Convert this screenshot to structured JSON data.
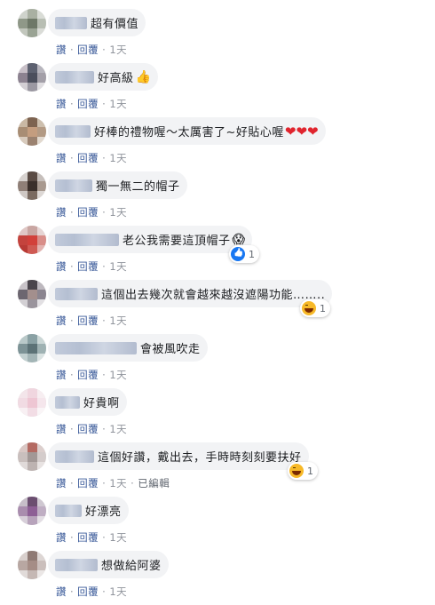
{
  "actions": {
    "like": "讚",
    "reply": "回覆",
    "separator": "·"
  },
  "comments": [
    {
      "text": "超有價值",
      "time": "1天",
      "edited": ""
    },
    {
      "text": "好高級",
      "emoji": "👍",
      "time": "1天",
      "edited": ""
    },
    {
      "text": "好棒的禮物喔～太厲害了~好貼心喔",
      "emoji": "❤❤❤",
      "time": "1天",
      "edited": ""
    },
    {
      "text": "獨一無二的帽子",
      "time": "1天",
      "edited": ""
    },
    {
      "text": "老公我需要這頂帽子",
      "emoji": "😱",
      "time": "1天",
      "edited": "",
      "reaction": {
        "icon": "like-icon",
        "count": "1"
      }
    },
    {
      "text": "這個出去幾次就會越來越沒遮陽功能……..",
      "time": "1天",
      "edited": "",
      "reaction": {
        "icon": "haha-icon",
        "count": "1"
      }
    },
    {
      "text": "會被風吹走",
      "time": "1天",
      "edited": ""
    },
    {
      "text": "好貴啊",
      "time": "1天",
      "edited": ""
    },
    {
      "text": "這個好讚，戴出去，手時時刻刻要扶好",
      "time": "1天",
      "edited": "已編輯",
      "reaction": {
        "icon": "haha-icon",
        "count": "1"
      }
    },
    {
      "text": "好漂亮",
      "time": "1天",
      "edited": ""
    },
    {
      "text": "想做給阿婆",
      "time": "1天",
      "edited": ""
    }
  ]
}
